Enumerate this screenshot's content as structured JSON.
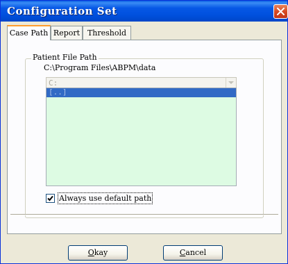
{
  "window": {
    "title": "Configuration Set"
  },
  "tabs": [
    {
      "label": "Case Path",
      "active": true
    },
    {
      "label": "Report",
      "active": false
    },
    {
      "label": "Threshold",
      "active": false
    }
  ],
  "patient_file_path": {
    "group_label": "Patient File Path",
    "path": "C:\\Program Files\\ABPM\\data",
    "drive": {
      "value": "C:",
      "enabled": false
    },
    "directory_list": {
      "items": [
        "[..]"
      ],
      "selected_index": 0
    }
  },
  "always_default": {
    "label": "Always use default path",
    "checked": true
  },
  "buttons": {
    "okay": {
      "mnemonic": "O",
      "rest": "kay"
    },
    "cancel": {
      "mnemonic": "C",
      "rest": "ancel"
    }
  },
  "colors": {
    "titlebar": "#0054e3",
    "list_background": "#ddfbe3",
    "selection": "#316ac5",
    "close_button": "#d84a22"
  },
  "icons": [
    "close-icon",
    "dropdown-arrow-icon",
    "checkmark-icon"
  ]
}
